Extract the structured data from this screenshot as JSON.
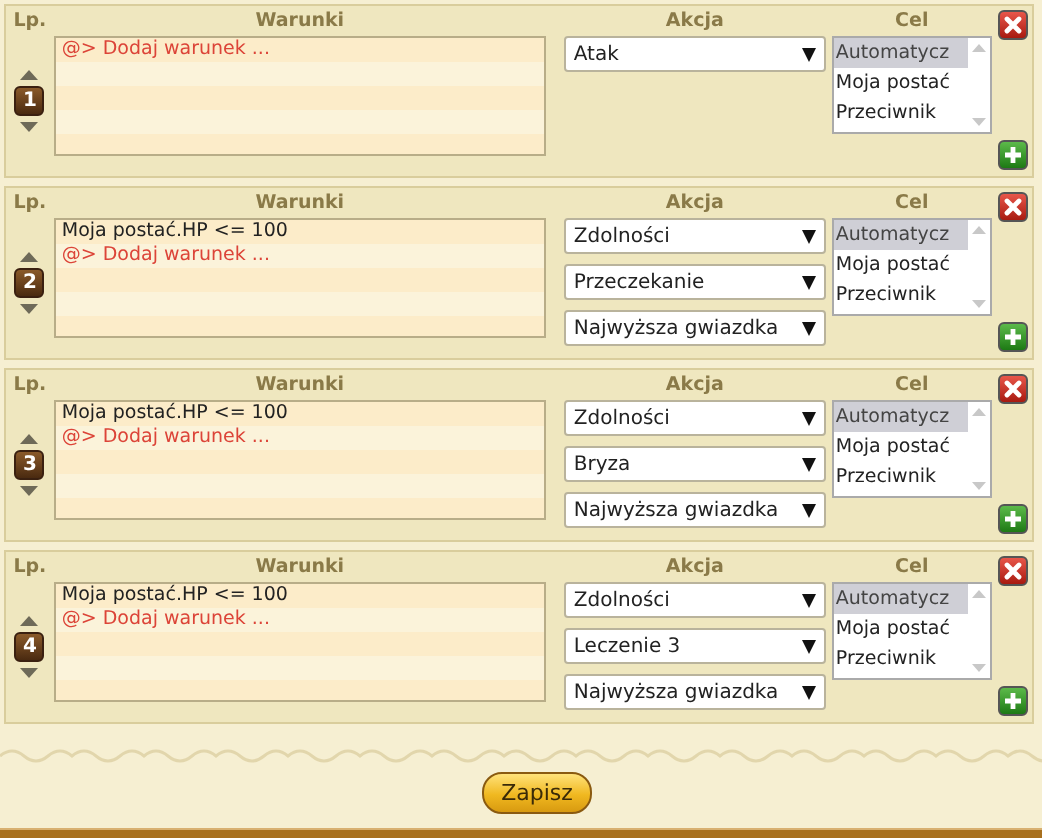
{
  "rules": [
    {
      "columns": [
        "Lp.",
        "Warunki",
        "Akcja",
        "Cel"
      ],
      "number": "1",
      "conditions": [
        {
          "kind": "add",
          "text": "@> Dodaj warunek ..."
        }
      ],
      "actions": [
        "Atak"
      ],
      "target": [
        {
          "label": "Automatycz",
          "selected": true
        },
        {
          "label": "Moja postać",
          "selected": false
        },
        {
          "label": "Przeciwnik",
          "selected": false
        }
      ]
    },
    {
      "columns": [
        "Lp.",
        "Warunki",
        "Akcja",
        "Cel"
      ],
      "number": "2",
      "conditions": [
        {
          "kind": "condition",
          "text": "Moja postać.HP <= 100"
        },
        {
          "kind": "add",
          "text": "@> Dodaj warunek ..."
        }
      ],
      "actions": [
        "Zdolności",
        "Przeczekanie",
        "Najwyższa gwiazdka"
      ],
      "target": [
        {
          "label": "Automatycz",
          "selected": true
        },
        {
          "label": "Moja postać",
          "selected": false
        },
        {
          "label": "Przeciwnik",
          "selected": false
        }
      ]
    },
    {
      "columns": [
        "Lp.",
        "Warunki",
        "Akcja",
        "Cel"
      ],
      "number": "3",
      "conditions": [
        {
          "kind": "condition",
          "text": "Moja postać.HP <= 100"
        },
        {
          "kind": "add",
          "text": "@> Dodaj warunek ..."
        }
      ],
      "actions": [
        "Zdolności",
        "Bryza",
        "Najwyższa gwiazdka"
      ],
      "target": [
        {
          "label": "Automatycz",
          "selected": true
        },
        {
          "label": "Moja postać",
          "selected": false
        },
        {
          "label": "Przeciwnik",
          "selected": false
        }
      ]
    },
    {
      "columns": [
        "Lp.",
        "Warunki",
        "Akcja",
        "Cel"
      ],
      "number": "4",
      "conditions": [
        {
          "kind": "condition",
          "text": "Moja postać.HP <= 100"
        },
        {
          "kind": "add",
          "text": "@> Dodaj warunek ..."
        }
      ],
      "actions": [
        "Zdolności",
        "Leczenie 3",
        "Najwyższa gwiazdka"
      ],
      "target": [
        {
          "label": "Automatycz",
          "selected": true
        },
        {
          "label": "Moja postać",
          "selected": false
        },
        {
          "label": "Przeciwnik",
          "selected": false
        }
      ]
    }
  ],
  "save_button": "Zapisz"
}
